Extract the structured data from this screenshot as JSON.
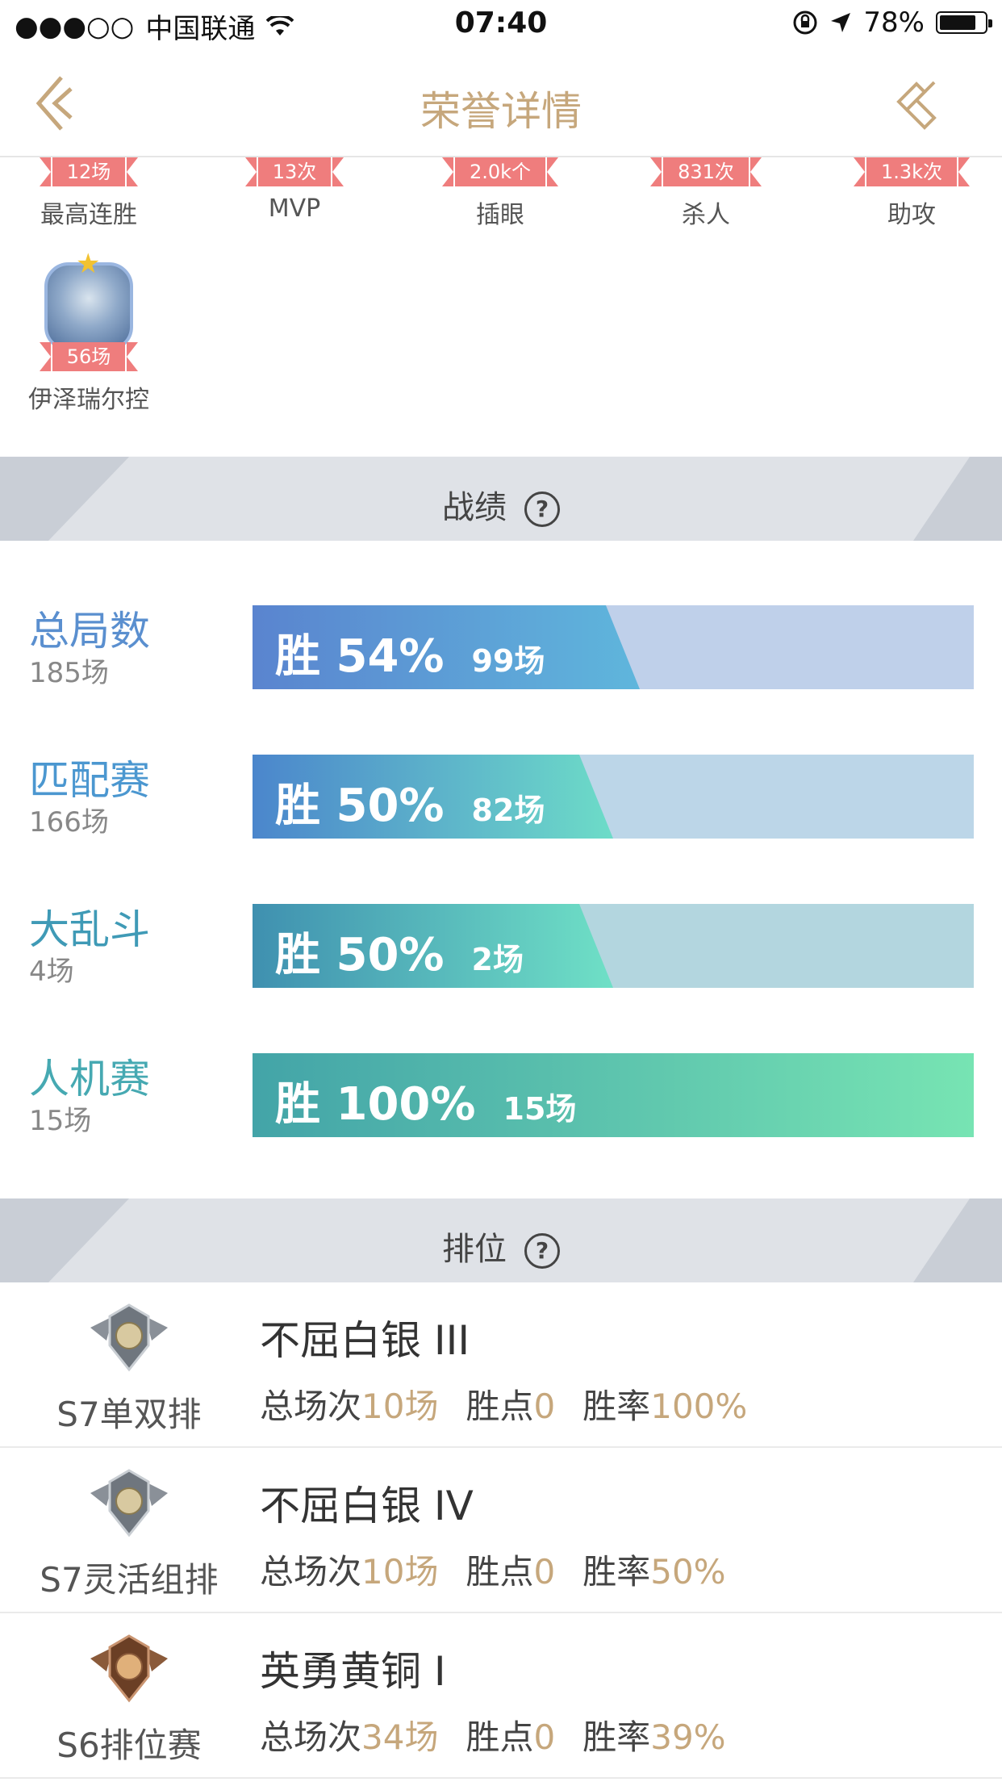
{
  "status_bar": {
    "signal": "●●●○○",
    "carrier": "中国联通",
    "time": "07:40",
    "battery": "78%"
  },
  "nav": {
    "title": "荣誉详情"
  },
  "honors": [
    {
      "value": "12场",
      "label": "最高连胜"
    },
    {
      "value": "13次",
      "label": "MVP"
    },
    {
      "value": "2.0k个",
      "label": "插眼"
    },
    {
      "value": "831次",
      "label": "杀人"
    },
    {
      "value": "1.3k次",
      "label": "助攻"
    }
  ],
  "hero": {
    "value": "56场",
    "label": "伊泽瑞尔控"
  },
  "record_section": {
    "title": "战绩"
  },
  "records": [
    {
      "name": "总局数",
      "count": "185场",
      "win": "胜 54%",
      "games": "99场",
      "win_rate": 0.54,
      "name_color": "#5a8fcf"
    },
    {
      "name": "匹配赛",
      "count": "166场",
      "win": "胜 50%",
      "games": "82场",
      "win_rate": 0.5,
      "name_color": "#4b97d0"
    },
    {
      "name": "大乱斗",
      "count": "4场",
      "win": "胜 50%",
      "games": "2场",
      "win_rate": 0.5,
      "name_color": "#3f9ab6"
    },
    {
      "name": "人机赛",
      "count": "15场",
      "win": "胜 100%",
      "games": "15场",
      "win_rate": 1.0,
      "name_color": "#46a9b2"
    }
  ],
  "rank_section": {
    "title": "排位"
  },
  "ranks": [
    {
      "season": "S7单双排",
      "title": "不屈白银 III",
      "total_label": "总场次",
      "total": "10场",
      "points_label": "胜点",
      "points": "0",
      "rate_label": "胜率",
      "rate": "100%",
      "badge": "silver"
    },
    {
      "season": "S7灵活组排",
      "title": "不屈白银 IV",
      "total_label": "总场次",
      "total": "10场",
      "points_label": "胜点",
      "points": "0",
      "rate_label": "胜率",
      "rate": "50%",
      "badge": "silver"
    },
    {
      "season": "S6排位赛",
      "title": "英勇黄铜 I",
      "total_label": "总场次",
      "total": "34场",
      "points_label": "胜点",
      "points": "0",
      "rate_label": "胜率",
      "rate": "39%",
      "badge": "bronze"
    }
  ]
}
